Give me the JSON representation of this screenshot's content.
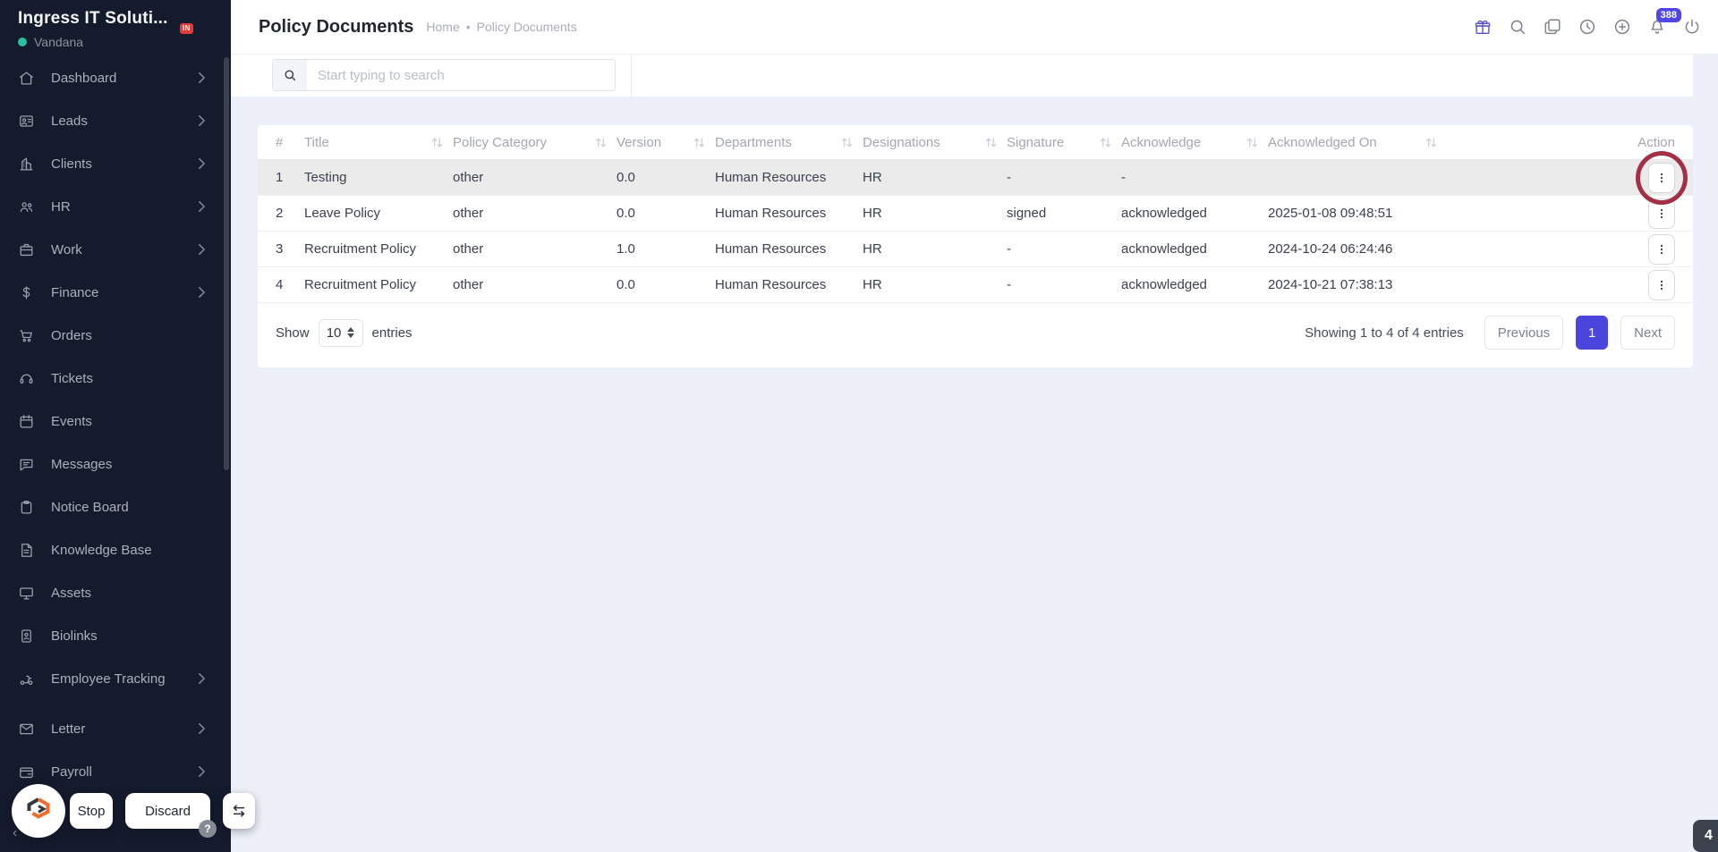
{
  "app": {
    "accent": "#4f46e5",
    "sidebar_bg": "#141b2c",
    "annotation_red": "#a33047",
    "brand_green": "#2abf9e",
    "badge_red": "#e03a3a"
  },
  "sidebar": {
    "brand": "Ingress IT Soluti...",
    "brand_badge": "IN",
    "workspace": "Vandana",
    "items": [
      {
        "label": "Dashboard",
        "icon": "home-icon",
        "chevron": true
      },
      {
        "label": "Leads",
        "icon": "leads-icon",
        "chevron": true
      },
      {
        "label": "Clients",
        "icon": "clients-icon",
        "chevron": true
      },
      {
        "label": "HR",
        "icon": "hr-icon",
        "chevron": true
      },
      {
        "label": "Work",
        "icon": "work-icon",
        "chevron": true
      },
      {
        "label": "Finance",
        "icon": "finance-icon",
        "chevron": true
      },
      {
        "label": "Orders",
        "icon": "orders-icon",
        "chevron": false
      },
      {
        "label": "Tickets",
        "icon": "tickets-icon",
        "chevron": false
      },
      {
        "label": "Events",
        "icon": "events-icon",
        "chevron": false
      },
      {
        "label": "Messages",
        "icon": "messages-icon",
        "chevron": false
      },
      {
        "label": "Notice Board",
        "icon": "notice-board-icon",
        "chevron": false
      },
      {
        "label": "Knowledge Base",
        "icon": "knowledge-base-icon",
        "chevron": false
      },
      {
        "label": "Assets",
        "icon": "assets-icon",
        "chevron": false
      },
      {
        "label": "Biolinks",
        "icon": "biolinks-icon",
        "chevron": false
      },
      {
        "label": "Employee Tracking",
        "icon": "employee-tracking-icon",
        "chevron": true
      },
      {
        "label": "Letter",
        "icon": "letter-icon",
        "chevron": true
      },
      {
        "label": "Payroll",
        "icon": "payroll-icon",
        "chevron": true
      }
    ]
  },
  "header": {
    "title": "Policy Documents",
    "breadcrumb": {
      "home": "Home",
      "separator": "•",
      "current": "Policy Documents"
    },
    "actions": [
      {
        "icon": "gift-icon"
      },
      {
        "icon": "search-icon"
      },
      {
        "icon": "copy-icon"
      },
      {
        "icon": "clock-icon"
      },
      {
        "icon": "plus-circle-icon"
      },
      {
        "icon": "bell-icon",
        "badge": "388"
      },
      {
        "icon": "power-icon"
      }
    ]
  },
  "toolbar": {
    "search_placeholder": "Start typing to search"
  },
  "table": {
    "columns": [
      {
        "label": "#",
        "sortable": false
      },
      {
        "label": "Title",
        "sortable": true
      },
      {
        "label": "Policy Category",
        "sortable": true
      },
      {
        "label": "Version",
        "sortable": true
      },
      {
        "label": "Departments",
        "sortable": true
      },
      {
        "label": "Designations",
        "sortable": true
      },
      {
        "label": "Signature",
        "sortable": true
      },
      {
        "label": "Acknowledge",
        "sortable": true
      },
      {
        "label": "Acknowledged On",
        "sortable": true
      },
      {
        "label": "Action",
        "sortable": false
      }
    ],
    "rows": [
      {
        "num": "1",
        "title": "Testing",
        "category": "other",
        "version": "0.0",
        "departments": "Human Resources",
        "designations": "HR",
        "signature": "-",
        "acknowledge": "-",
        "acknowledged_on": "",
        "highlighted": true,
        "action_annotated": true
      },
      {
        "num": "2",
        "title": "Leave Policy",
        "category": "other",
        "version": "0.0",
        "departments": "Human Resources",
        "designations": "HR",
        "signature": "signed",
        "acknowledge": "acknowledged",
        "acknowledged_on": "2025-01-08 09:48:51"
      },
      {
        "num": "3",
        "title": "Recruitment Policy",
        "category": "other",
        "version": "1.0",
        "departments": "Human Resources",
        "designations": "HR",
        "signature": "-",
        "acknowledge": "acknowledged",
        "acknowledged_on": "2024-10-24 06:24:46"
      },
      {
        "num": "4",
        "title": "Recruitment Policy",
        "category": "other",
        "version": "0.0",
        "departments": "Human Resources",
        "designations": "HR",
        "signature": "-",
        "acknowledge": "acknowledged",
        "acknowledged_on": "2024-10-21 07:38:13"
      }
    ]
  },
  "pagination": {
    "show_label": "Show",
    "page_size": "10",
    "entries_label": "entries",
    "summary": "Showing 1 to 4 of 4 entries",
    "previous_label": "Previous",
    "current_page": "1",
    "next_label": "Next"
  },
  "floating": {
    "stop_label": "Stop",
    "discard_label": "Discard",
    "help_badge": "?",
    "page_badge": "4"
  }
}
